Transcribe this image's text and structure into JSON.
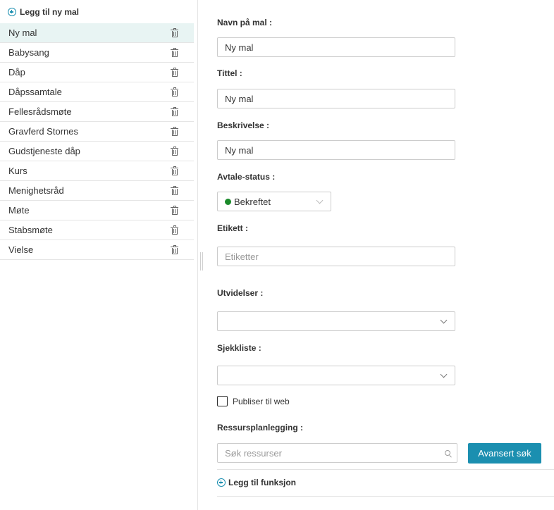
{
  "sidebar": {
    "add_label": "Legg til ny mal",
    "items": [
      {
        "label": "Ny mal",
        "active": true
      },
      {
        "label": "Babysang"
      },
      {
        "label": "Dåp"
      },
      {
        "label": "Dåpssamtale"
      },
      {
        "label": "Fellesrådsmøte"
      },
      {
        "label": "Gravferd Stornes"
      },
      {
        "label": "Gudstjeneste dåp"
      },
      {
        "label": "Kurs"
      },
      {
        "label": "Menighetsråd"
      },
      {
        "label": "Møte"
      },
      {
        "label": "Stabsmøte"
      },
      {
        "label": "Vielse"
      }
    ]
  },
  "form": {
    "name_label": "Navn på mal :",
    "name_value": "Ny mal",
    "title_label": "Tittel :",
    "title_value": "Ny mal",
    "description_label": "Beskrivelse :",
    "description_value": "Ny mal",
    "status_label": "Avtale-status :",
    "status_value": "Bekreftet",
    "status_color": "#1a8a2a",
    "tag_label": "Etikett :",
    "tag_placeholder": "Etiketter",
    "extensions_label": "Utvidelser :",
    "checklist_label": "Sjekkliste :",
    "publish_label": "Publiser til web",
    "resource_label": "Ressursplanlegging :",
    "resource_placeholder": "Søk ressurser",
    "advanced_search_label": "Avansert søk",
    "add_function_label": "Legg til funksjon"
  },
  "colors": {
    "accent": "#1b8fb0",
    "active_row": "#e8f4f3"
  }
}
